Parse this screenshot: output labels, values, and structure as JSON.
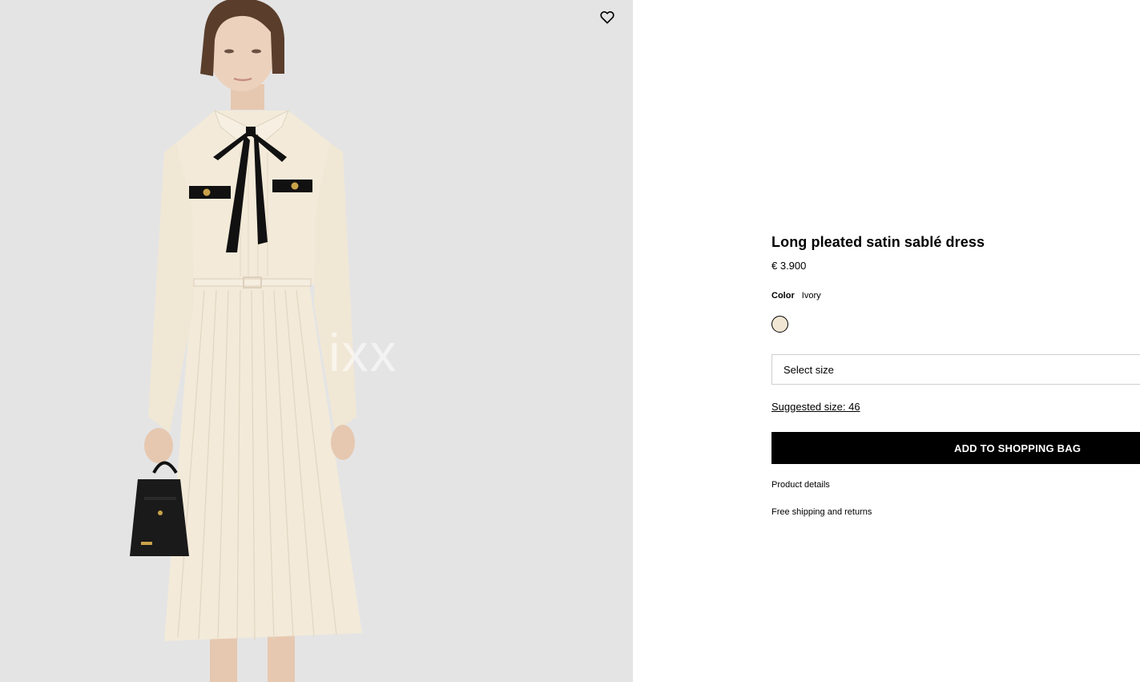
{
  "product": {
    "title": "Long pleated satin sablé dress",
    "price": "€ 3.900",
    "color_label": "Color",
    "color_value": "Ivory",
    "swatch_color": "#f1e6d4"
  },
  "size": {
    "placeholder": "Select size",
    "suggested": "Suggested size: 46"
  },
  "actions": {
    "add_to_bag": "ADD TO SHOPPING BAG"
  },
  "links": {
    "product_details": "Product details",
    "shipping": "Free shipping and returns"
  },
  "image": {
    "watermark": "ixx",
    "wishlist_icon": "heart-icon"
  },
  "colors": {
    "image_background": "#e4e4e5",
    "button_background": "#000000",
    "dress": "#f3ead9",
    "accent_black": "#111111"
  }
}
